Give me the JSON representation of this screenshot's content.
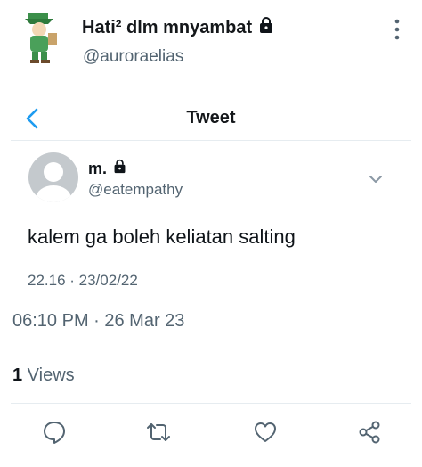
{
  "header": {
    "display_name": "Hati² dlm mnyambat",
    "handle": "@auroraelias",
    "avatar_icon": "green-character-avatar",
    "more_icon": "vertical-dots-icon"
  },
  "nav": {
    "title": "Tweet",
    "back_icon": "back-arrow-icon"
  },
  "quoted_tweet": {
    "name": "m.",
    "handle": "@eatempathy",
    "text": "kalem ga boleh keliatan salting",
    "time": "22.16 · 23/02/22"
  },
  "tweet": {
    "timestamp": "06:10 PM · 26 Mar 23",
    "views_count": "1",
    "views_label": " Views"
  },
  "actions": [
    "reply-icon",
    "retweet-icon",
    "like-icon",
    "share-icon"
  ],
  "colors": {
    "text": "#0f1419",
    "secondary": "#536471",
    "accent": "#1d9bf0",
    "divider": "#e6ecf0"
  }
}
